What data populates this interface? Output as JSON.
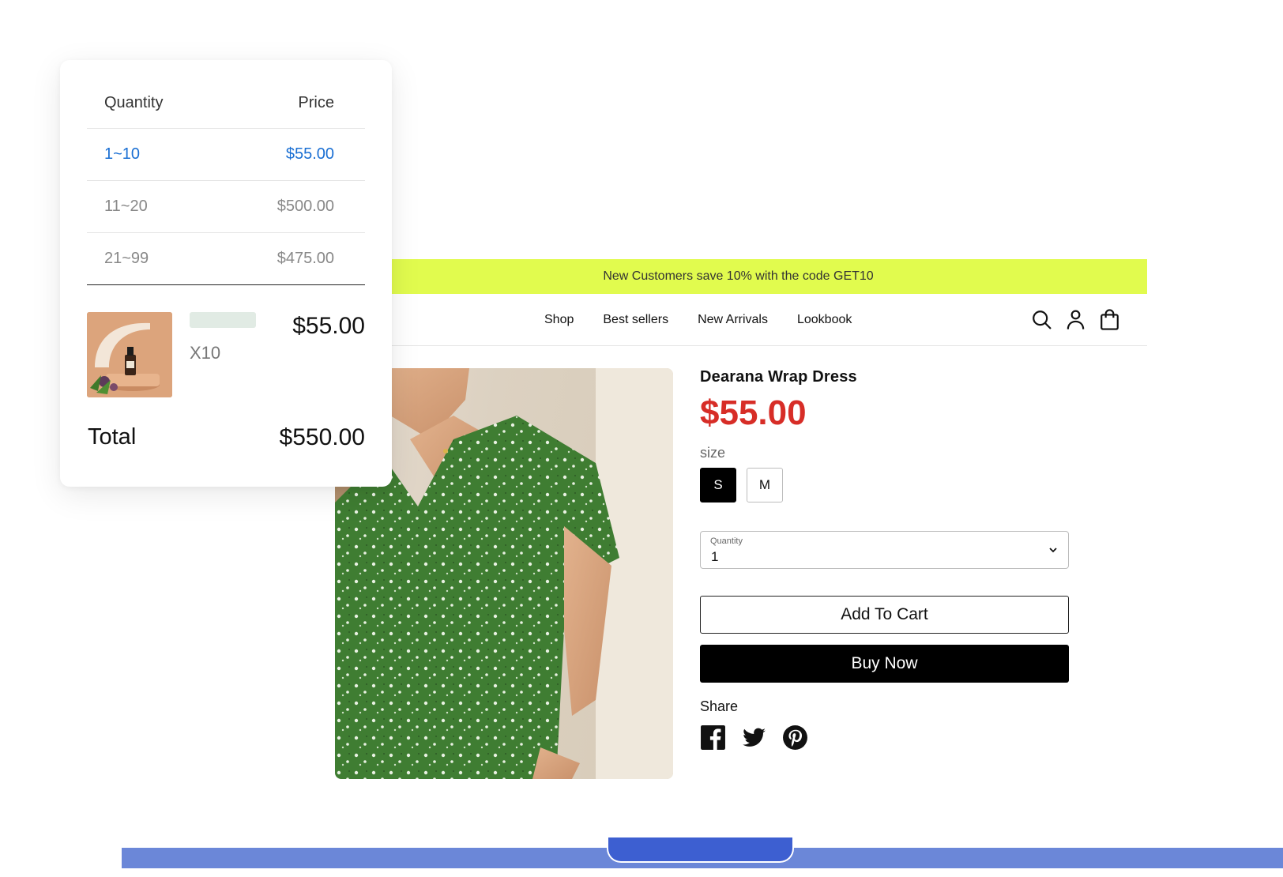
{
  "colors": {
    "announcement_bg": "#e1fb4e",
    "sale_price": "#d72d27",
    "active_tier": "#1a6fd3",
    "bottom_bar": "#6b87d8"
  },
  "announcement": {
    "text": "New Customers save 10% with the code GET10"
  },
  "nav": {
    "links": [
      "Shop",
      "Best sellers",
      "New Arrivals",
      "Lookbook"
    ]
  },
  "header_icons": [
    "search-icon",
    "account-icon",
    "bag-icon"
  ],
  "product": {
    "title": "Dearana Wrap Dress",
    "price": "$55.00",
    "size_label": "size",
    "sizes": [
      "S",
      "M"
    ],
    "selected_size": "S",
    "quantity": {
      "label": "Quantity",
      "value": "1"
    },
    "add_to_cart": "Add To Cart",
    "buy_now": "Buy Now",
    "share_label": "Share",
    "share_icons": [
      "facebook-icon",
      "twitter-icon",
      "pinterest-icon"
    ]
  },
  "pricing_card": {
    "headers": {
      "quantity": "Quantity",
      "price": "Price"
    },
    "tiers": [
      {
        "range": "1~10",
        "price": "$55.00",
        "active": true
      },
      {
        "range": "11~20",
        "price": "$500.00",
        "active": false
      },
      {
        "range": "21~99",
        "price": "$475.00",
        "active": false
      }
    ],
    "item": {
      "qty": "X10",
      "price": "$55.00"
    },
    "total": {
      "label": "Total",
      "value": "$550.00"
    }
  }
}
